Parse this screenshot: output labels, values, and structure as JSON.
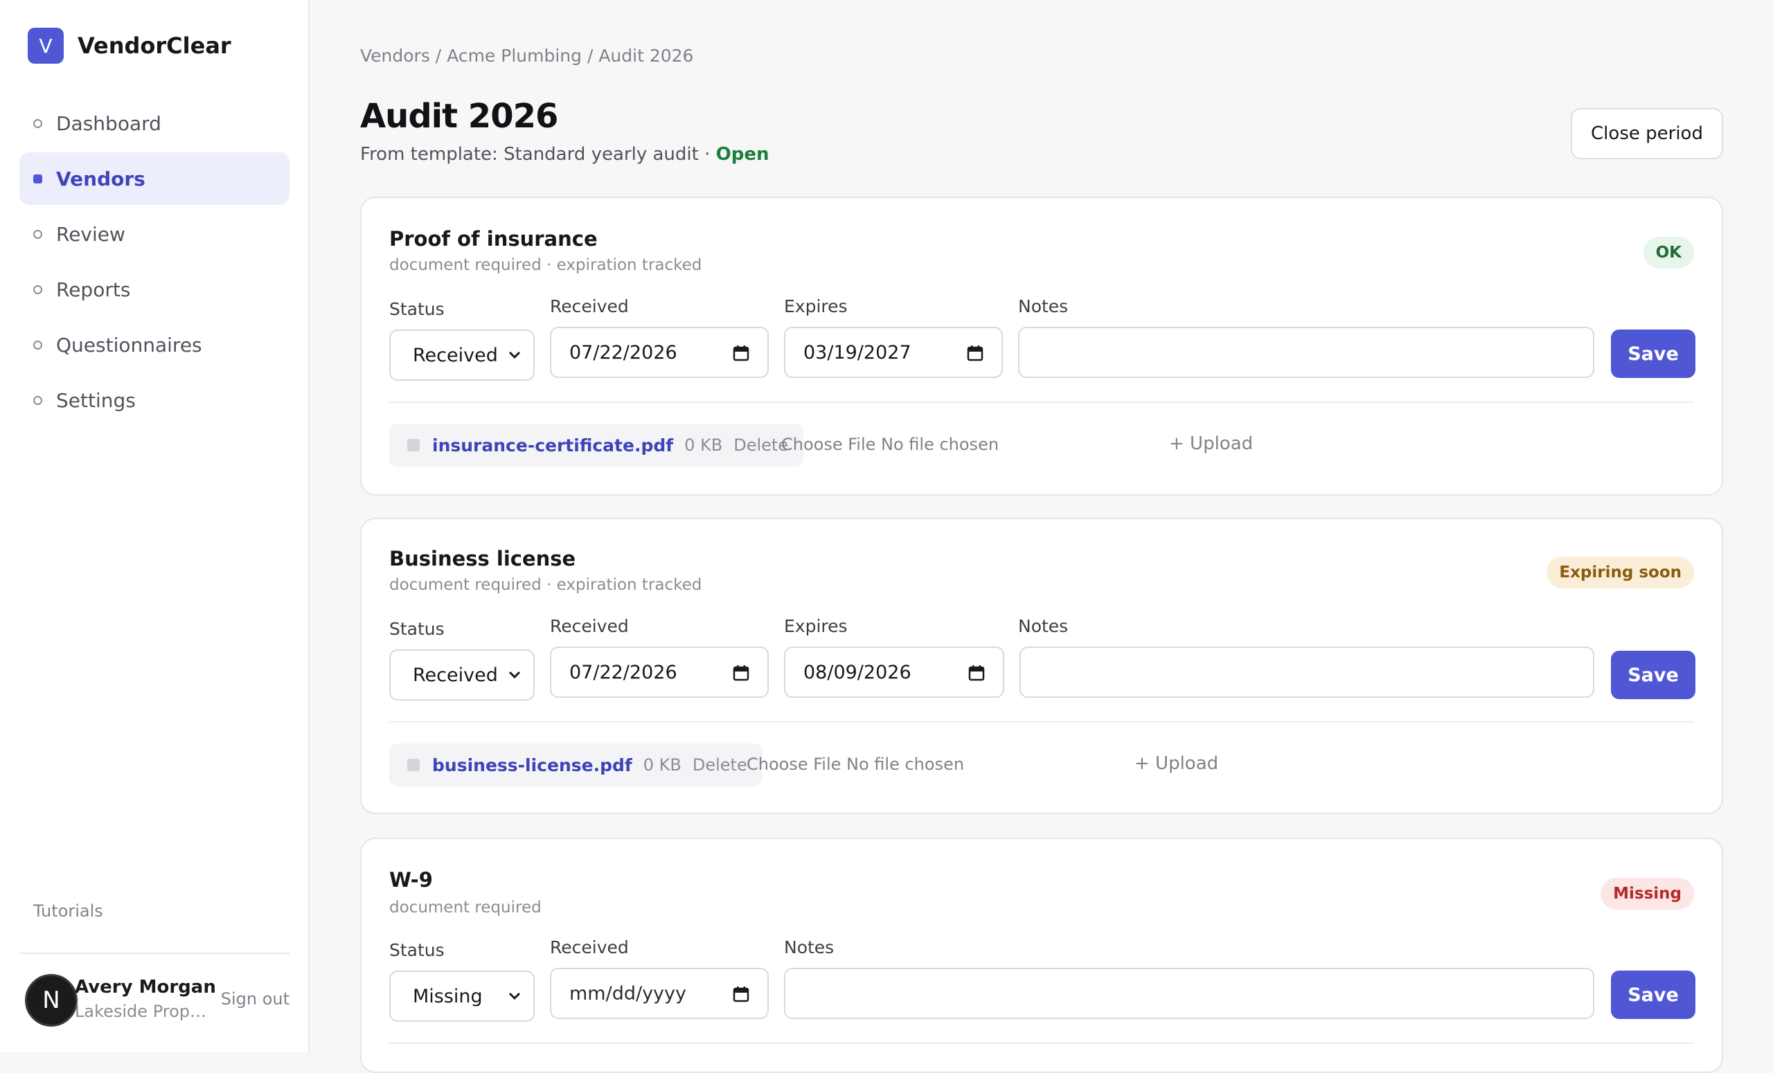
{
  "app": {
    "logo_letter": "V",
    "name": "VendorClear"
  },
  "sidebar": {
    "items": [
      {
        "label": "Dashboard",
        "active": false
      },
      {
        "label": "Vendors",
        "active": true
      },
      {
        "label": "Review",
        "active": false
      },
      {
        "label": "Reports",
        "active": false
      },
      {
        "label": "Questionnaires",
        "active": false
      },
      {
        "label": "Settings",
        "active": false
      }
    ],
    "tutorials": "Tutorials",
    "user": {
      "initial": "N",
      "name": "Avery Morgan",
      "org": "Lakeside Properties",
      "signout": "Sign out"
    }
  },
  "header": {
    "breadcrumb": "Vendors / Acme Plumbing / Audit 2026",
    "title": "Audit 2026",
    "subtitle_prefix": "From template: Standard yearly audit · ",
    "status": "Open",
    "close_button": "Close period"
  },
  "labels": {
    "status": "Status",
    "received": "Received",
    "expires": "Expires",
    "notes": "Notes",
    "save": "Save",
    "delete": "Delete",
    "choose_file": "Choose File  No file chosen",
    "upload": "+ Upload"
  },
  "requirements": [
    {
      "title": "Proof of insurance",
      "meta": "document required · expiration tracked",
      "badge": "OK",
      "status_value": "Received",
      "received": "07/22/2026",
      "expires": "03/19/2027",
      "notes": "",
      "file": {
        "name": "insurance-certificate.pdf",
        "size": "0 KB"
      }
    },
    {
      "title": "Business license",
      "meta": "document required · expiration tracked",
      "badge": "Expiring soon",
      "status_value": "Received",
      "received": "07/22/2026",
      "expires": "08/09/2026",
      "notes": "",
      "file": {
        "name": "business-license.pdf",
        "size": "0 KB"
      }
    },
    {
      "title": "W-9",
      "meta": "document required",
      "badge": "Missing",
      "status_value": "Missing",
      "received": "mm/dd/yyyy",
      "notes": ""
    }
  ],
  "colors": {
    "accent": "#5057d5",
    "ok": "#216b34",
    "warn": "#8a5a10",
    "missing": "#b62a2a",
    "open": "#1e7f3d"
  }
}
